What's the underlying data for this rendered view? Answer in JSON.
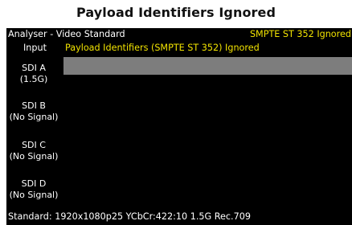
{
  "caption": "Payload Identifiers Ignored",
  "header": {
    "title": "Analyser - Video Standard",
    "alert": "SMPTE ST 352 Ignored"
  },
  "input_row": {
    "label": "Input",
    "message": "Payload Identifiers (SMPTE ST 352) Ignored"
  },
  "channels": [
    {
      "name": "SDI A",
      "status": "(1.5G)"
    },
    {
      "name": "SDI B",
      "status": "(No Signal)"
    },
    {
      "name": "SDI C",
      "status": "(No Signal)"
    },
    {
      "name": "SDI D",
      "status": "(No Signal)"
    }
  ],
  "status": {
    "standard_line": "Standard: 1920x1080p25 YCbCr:422:10 1.5G Rec.709"
  },
  "colors": {
    "background": "#000000",
    "text": "#ffffff",
    "alert": "#f2e300",
    "bar": "#7d7d7d"
  }
}
